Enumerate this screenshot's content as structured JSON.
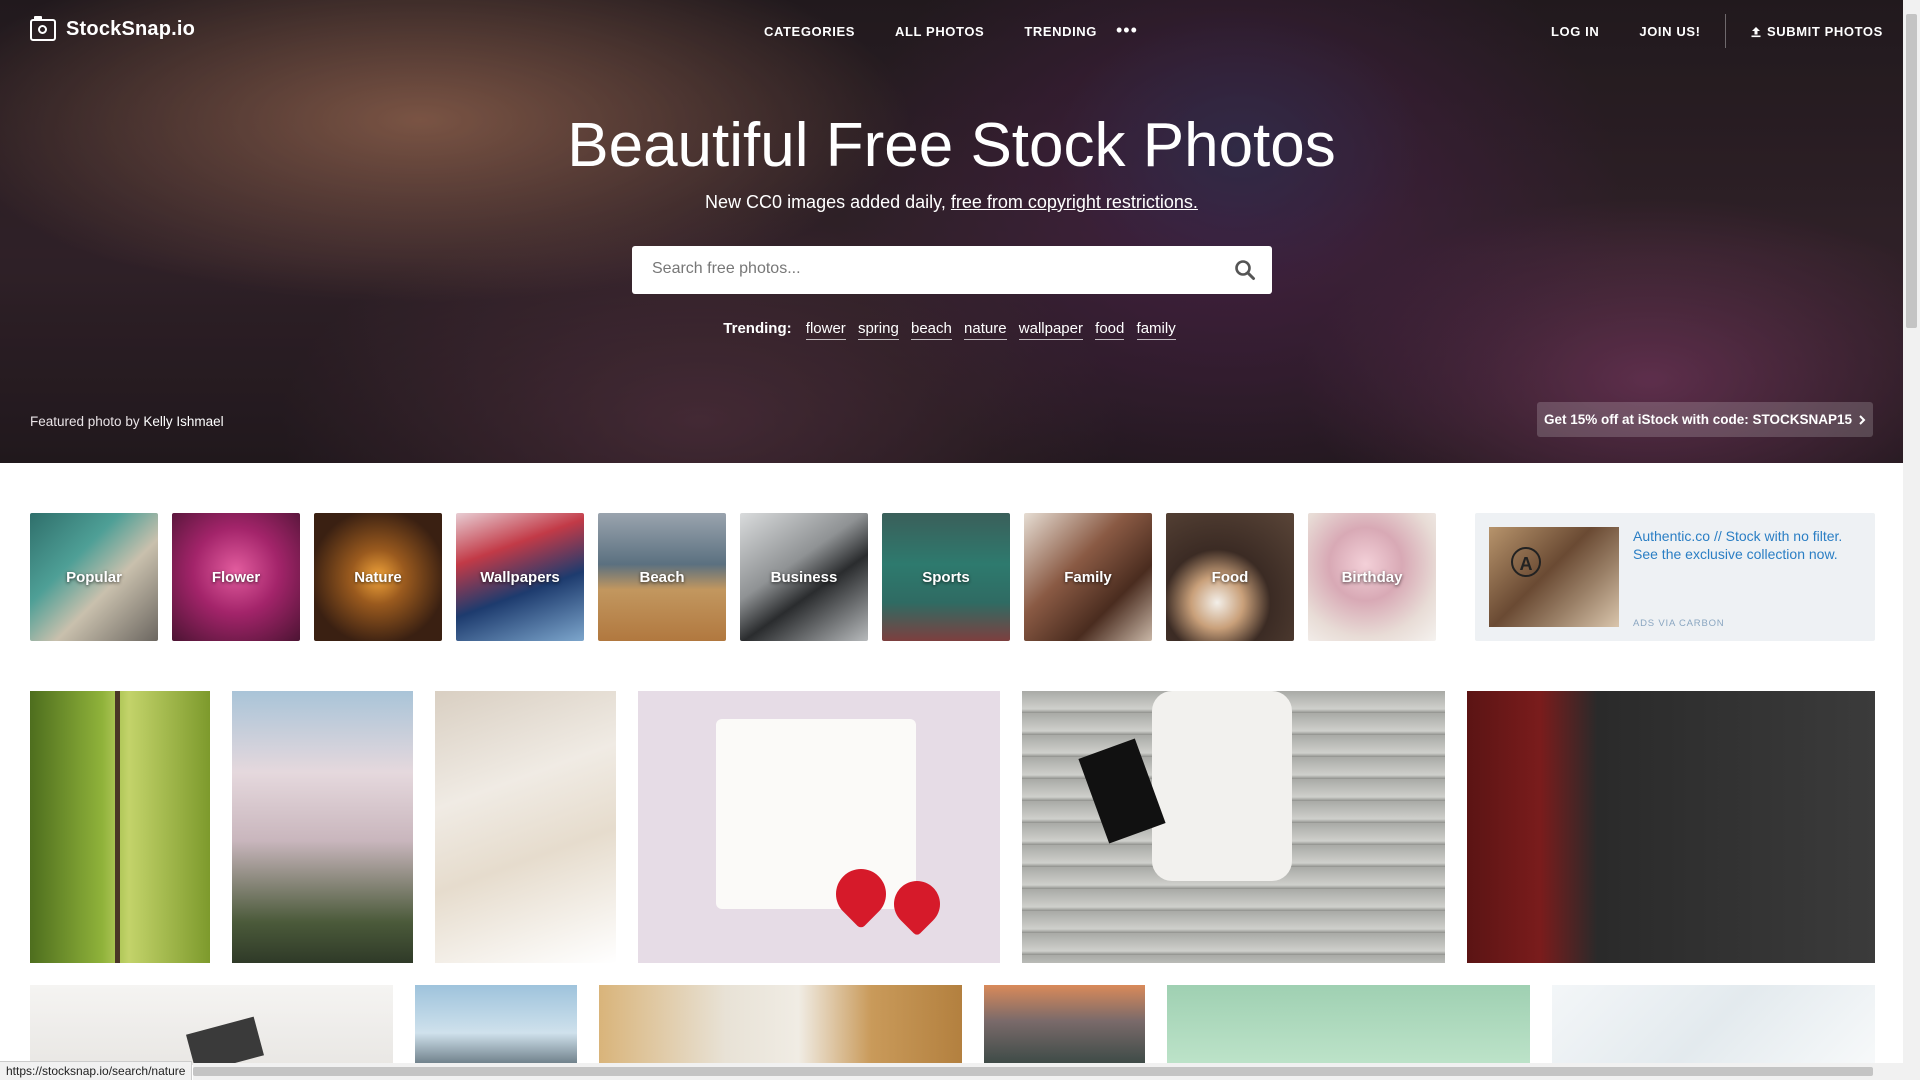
{
  "nav": {
    "logo": "StockSnap.io",
    "links": [
      "CATEGORIES",
      "ALL PHOTOS",
      "TRENDING"
    ],
    "more": "•••",
    "right": [
      "LOG IN",
      "JOIN US!"
    ],
    "submit": "SUBMIT PHOTOS"
  },
  "hero": {
    "title": "Beautiful Free Stock Photos",
    "subtitle_plain": "New CC0 images added daily,",
    "subtitle_link": "free from copyright restrictions.",
    "search_placeholder": "Search free photos...",
    "trending_label": "Trending:",
    "trending_tags": [
      "flower",
      "spring",
      "beach",
      "nature",
      "wallpaper",
      "food",
      "family"
    ],
    "featured_prefix": "Featured photo by",
    "featured_author": "Kelly Ishmael",
    "promo": "Get 15% off at iStock with code: STOCKSNAP15"
  },
  "categories": [
    "Popular",
    "Flower",
    "Nature",
    "Wallpapers",
    "Beach",
    "Business",
    "Sports",
    "Family",
    "Food",
    "Birthday"
  ],
  "ad": {
    "text": "Authentic.co // Stock with no filter. See the exclusive collection now.",
    "footer": "ADS VIA CARBON"
  },
  "status_url": "https://stocksnap.io/search/nature"
}
